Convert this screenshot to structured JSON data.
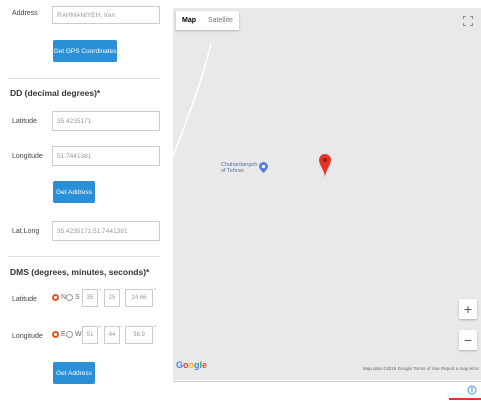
{
  "address": {
    "label": "Address",
    "value": "RAHMANIYEH, Iran",
    "button": "Get GPS Coordinates"
  },
  "dd": {
    "heading": "DD (decimal degrees)*",
    "lat_label": "Latitude",
    "lat_value": "35.4235171",
    "lng_label": "Longitude",
    "lng_value": "51.7441381",
    "button": "Get Address"
  },
  "latlong": {
    "label": "Lat,Long",
    "value": "35.4235171,51.7441381"
  },
  "dms": {
    "heading": "DMS (degrees, minutes, seconds)*",
    "lat": {
      "label": "Latitude",
      "dir1": "N",
      "dir2": "S",
      "deg": "35",
      "min": "25",
      "sec": "24.66"
    },
    "lng": {
      "label": "Longitude",
      "dir1": "E",
      "dir2": "W",
      "deg": "51",
      "min": "44",
      "sec": "38.9"
    },
    "deg_unit": "°",
    "min_unit": "'",
    "sec_unit": "\"",
    "button": "Get Address"
  },
  "map": {
    "map_tab": "Map",
    "satellite_tab": "Satellite",
    "poi_name": "Chahardangeh\nof Tehran",
    "zoom_in": "+",
    "zoom_out": "−",
    "google": "Google",
    "attribution": "Map data ©2019 Google   Terms of Use   Report a map error",
    "colors": {
      "pin": "#e4342a",
      "poi": "#5a7be0",
      "button": "#2a8fd6"
    }
  }
}
